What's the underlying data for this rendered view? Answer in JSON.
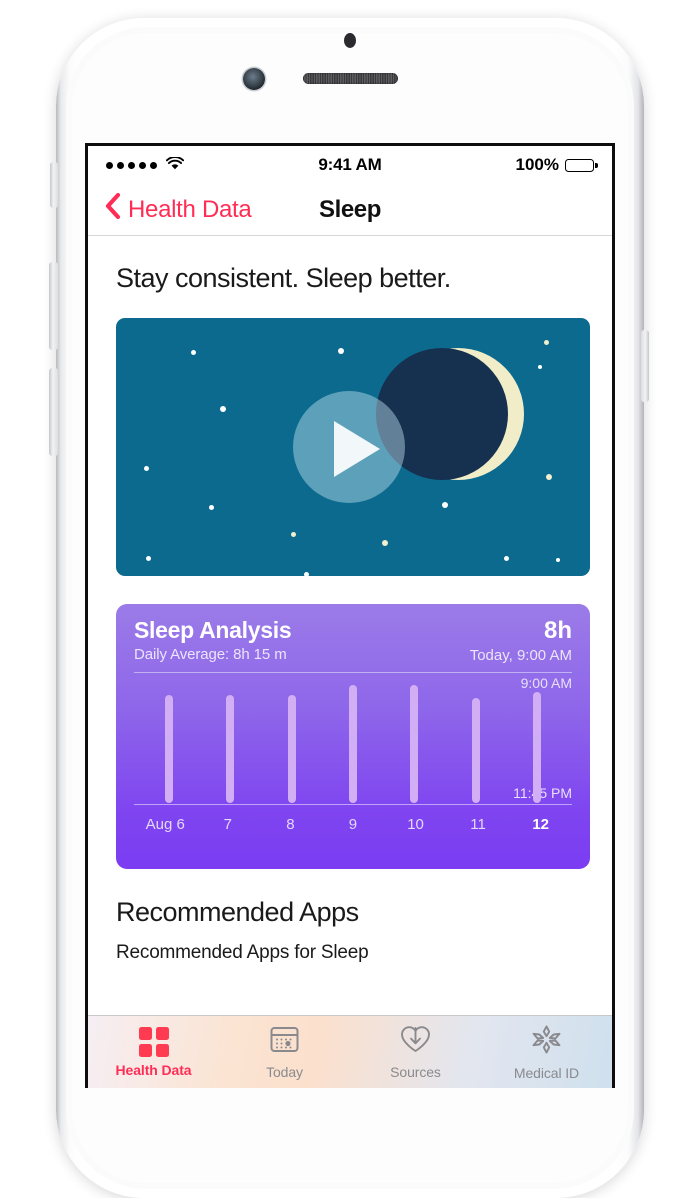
{
  "status_bar": {
    "signal_dots": 5,
    "wifi_icon": "wifi-icon",
    "time": "9:41 AM",
    "battery_percent": "100%",
    "battery_icon": "battery-full-icon"
  },
  "nav": {
    "back_icon": "chevron-left-icon",
    "back_label": "Health Data",
    "title": "Sleep",
    "back_color": "#FF2D55"
  },
  "main": {
    "headline": "Stay consistent. Sleep better.",
    "video": {
      "play_icon": "play-button-icon",
      "background_color": "#0C6A8E",
      "moon_lit_color": "#F0EDC8",
      "moon_dark_color": "#16304F"
    },
    "recommended": {
      "title": "Recommended Apps",
      "subtitle": "Recommended Apps for Sleep"
    }
  },
  "sleep_card": {
    "title": "Sleep Analysis",
    "subtitle": "Daily Average: 8h 15 m",
    "value": "8h",
    "value_when": "Today, 9:00 AM",
    "axis_top": "9:00 AM",
    "axis_bottom": "11:45 PM",
    "accent_color": "#7B3CF2",
    "bar_color": "#D2AEF5"
  },
  "chart_data": {
    "type": "bar",
    "title": "Sleep Analysis",
    "subtitle": "Daily Average: 8h 15 m",
    "categories": [
      "Aug 6",
      "7",
      "8",
      "9",
      "10",
      "11",
      "12"
    ],
    "values": [
      8.25,
      8.25,
      8.25,
      9.0,
      9.0,
      8.0,
      8.5
    ],
    "value_unit": "hours asleep",
    "bars": [
      {
        "label": "Aug 6",
        "height_pct": 84,
        "today": false
      },
      {
        "label": "7",
        "height_pct": 84,
        "today": false
      },
      {
        "label": "8",
        "height_pct": 84,
        "today": false
      },
      {
        "label": "9",
        "height_pct": 92,
        "today": false
      },
      {
        "label": "10",
        "height_pct": 92,
        "today": false
      },
      {
        "label": "11",
        "height_pct": 82,
        "today": false
      },
      {
        "label": "12",
        "height_pct": 87,
        "today": true
      }
    ],
    "ylabel": "",
    "xlabel": "",
    "y_top_tick": "9:00 AM",
    "y_bottom_tick": "11:45 PM",
    "ylim": [
      "11:45 PM",
      "9:00 AM"
    ],
    "grid": false,
    "legend": "none",
    "highlighted_category": "12"
  },
  "tabbar": {
    "tabs": [
      {
        "label": "Health Data",
        "icon": "health-squares-icon",
        "active": true
      },
      {
        "label": "Today",
        "icon": "calendar-icon",
        "active": false
      },
      {
        "label": "Sources",
        "icon": "heart-download-icon",
        "active": false
      },
      {
        "label": "Medical ID",
        "icon": "medical-asterisk-icon",
        "active": false
      }
    ]
  }
}
